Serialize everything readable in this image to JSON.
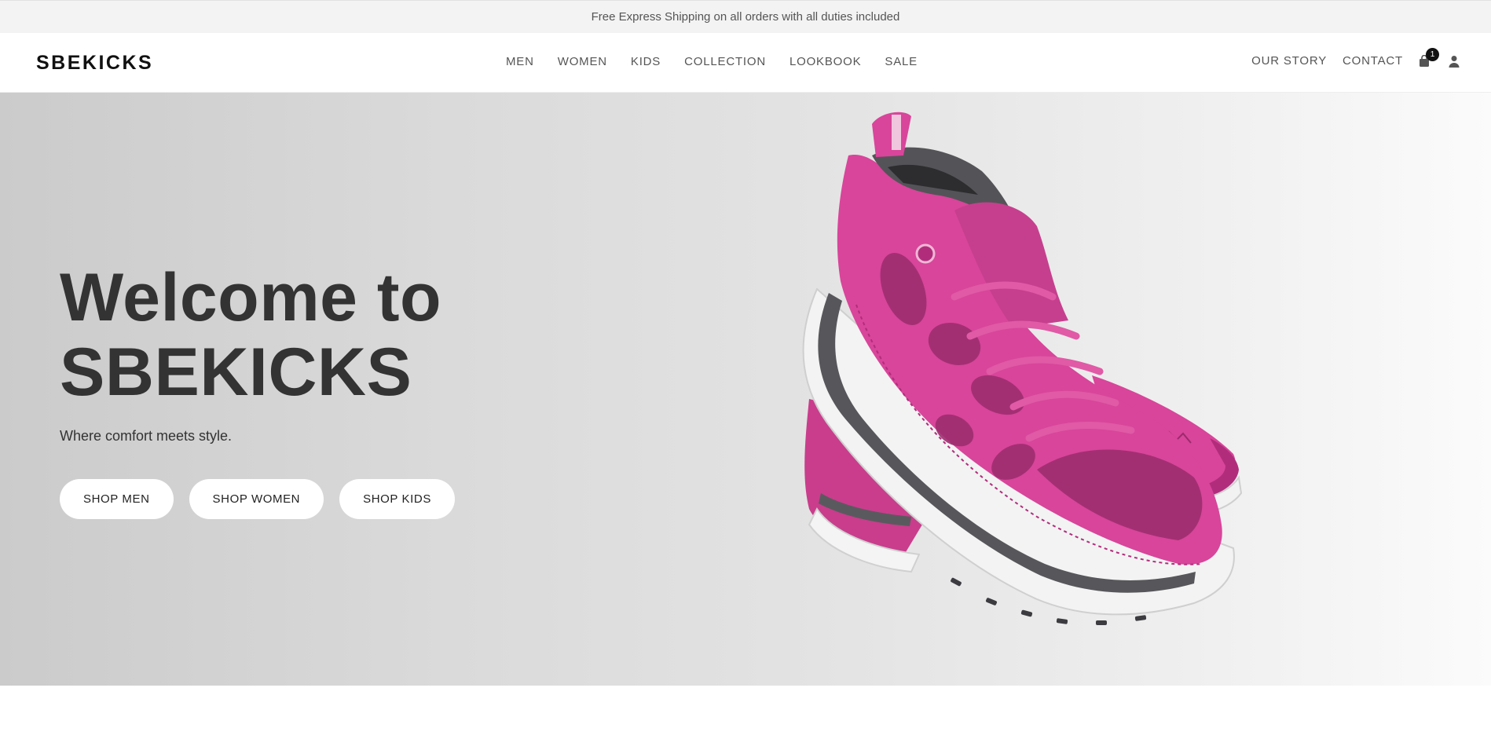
{
  "announcement": {
    "text": "Free Express Shipping on all orders with all duties included"
  },
  "header": {
    "logo": "SBEKICKS",
    "nav": [
      {
        "label": "MEN"
      },
      {
        "label": "WOMEN"
      },
      {
        "label": "KIDS"
      },
      {
        "label": "COLLECTION"
      },
      {
        "label": "LOOKBOOK"
      },
      {
        "label": "SALE"
      }
    ],
    "right_nav": [
      {
        "label": "OUR STORY"
      },
      {
        "label": "CONTACT"
      }
    ],
    "cart": {
      "icon": "shopping-bag-icon",
      "count": "1"
    },
    "account": {
      "icon": "user-icon"
    }
  },
  "hero": {
    "title_line1": "Welcome to",
    "title_line2": "SBEKICKS",
    "subtitle": "Where comfort meets style.",
    "buttons": [
      {
        "label": "SHOP MEN"
      },
      {
        "label": "SHOP WOMEN"
      },
      {
        "label": "SHOP KIDS"
      }
    ],
    "image": "pink-sneakers-image"
  },
  "colors": {
    "shoe_pink": "#d8459a",
    "shoe_dark_pink": "#b12d7c",
    "shoe_grey": "#545458",
    "text_dark": "#333333",
    "announcement_bg": "#f3f3f3"
  }
}
